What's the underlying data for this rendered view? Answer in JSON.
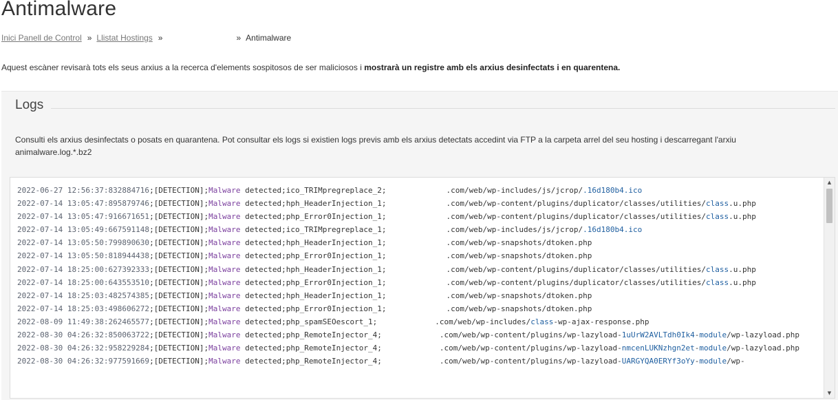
{
  "page": {
    "title": "Antimalware"
  },
  "breadcrumb": {
    "items": [
      {
        "label": "Inici Panell de Control"
      },
      {
        "label": "Llistat Hostings"
      },
      {
        "label": ""
      },
      {
        "label": "Antimalware"
      }
    ],
    "separator": "»"
  },
  "intro": {
    "text": "Aquest escàner revisarà tots els seus arxius a la recerca d'elements sospitosos de ser maliciosos i ",
    "bold": "mostrarà un registre amb els arxius desinfectats i en quarentena."
  },
  "logs": {
    "legend": "Logs",
    "description": "Consulti els arxius desinfectats o posats en quarantena. Pot consultar els logs si existien logs previs amb els arxius detectats accedint via FTP a la carpeta arrel del seu hosting i descarregant l'arxiu animalware.log.*.bz2",
    "entries": [
      {
        "ts": "2022-06-27 12:56:37:832884716",
        "tag": "[DETECTION]",
        "kw": "Malware",
        "det": " detected;",
        "sig": "ico_TRIMpregreplace_2;",
        "path": [
          ".com/web/wp-includes/js/jcrop/",
          ".16d180b4.ico"
        ]
      },
      {
        "ts": "2022-07-14 13:05:47:895879746",
        "tag": "[DETECTION]",
        "kw": "Malware",
        "det": " detected;",
        "sig": "hph_HeaderInjection_1;",
        "path": [
          ".com/web/wp-content/plugins/duplicator/classes/utilities/",
          "class",
          ".u.php"
        ]
      },
      {
        "ts": "2022-07-14 13:05:47:916671651",
        "tag": "[DETECTION]",
        "kw": "Malware",
        "det": " detected;",
        "sig": "php_Error0Injection_1;",
        "path": [
          ".com/web/wp-content/plugins/duplicator/classes/utilities/",
          "class",
          ".u.php"
        ]
      },
      {
        "ts": "2022-07-14 13:05:49:667591148",
        "tag": "[DETECTION]",
        "kw": "Malware",
        "det": " detected;",
        "sig": "ico_TRIMpregreplace_1;",
        "path": [
          ".com/web/wp-includes/js/jcrop/",
          ".16d180b4.ico"
        ]
      },
      {
        "ts": "2022-07-14 13:05:50:799890630",
        "tag": "[DETECTION]",
        "kw": "Malware",
        "det": " detected;",
        "sig": "hph_HeaderInjection_1;",
        "path": [
          ".com/web/wp-snapshots/dtoken.php"
        ]
      },
      {
        "ts": "2022-07-14 13:05:50:818944438",
        "tag": "[DETECTION]",
        "kw": "Malware",
        "det": " detected;",
        "sig": "php_Error0Injection_1;",
        "path": [
          ".com/web/wp-snapshots/dtoken.php"
        ]
      },
      {
        "ts": "2022-07-14 18:25:00:627392333",
        "tag": "[DETECTION]",
        "kw": "Malware",
        "det": " detected;",
        "sig": "hph_HeaderInjection_1;",
        "path": [
          ".com/web/wp-content/plugins/duplicator/classes/utilities/",
          "class",
          ".u.php"
        ]
      },
      {
        "ts": "2022-07-14 18:25:00:643553510",
        "tag": "[DETECTION]",
        "kw": "Malware",
        "det": " detected;",
        "sig": "php_Error0Injection_1;",
        "path": [
          ".com/web/wp-content/plugins/duplicator/classes/utilities/",
          "class",
          ".u.php"
        ]
      },
      {
        "ts": "2022-07-14 18:25:03:482574385",
        "tag": "[DETECTION]",
        "kw": "Malware",
        "det": " detected;",
        "sig": "hph_HeaderInjection_1;",
        "path": [
          ".com/web/wp-snapshots/dtoken.php"
        ]
      },
      {
        "ts": "2022-07-14 18:25:03:498606272",
        "tag": "[DETECTION]",
        "kw": "Malware",
        "det": " detected;",
        "sig": "php_Error0Injection_1;",
        "path": [
          ".com/web/wp-snapshots/dtoken.php"
        ]
      },
      {
        "ts": "2022-08-09 11:49:38:262465577",
        "tag": "[DETECTION]",
        "kw": "Malware",
        "det": " detected;",
        "sig": "php_spamSEOescort_1;",
        "path": [
          ".com/web/wp-includes/",
          "class",
          "-wp-ajax-response.php"
        ]
      },
      {
        "ts": "2022-08-30 04:26:32:850063722",
        "tag": "[DETECTION]",
        "kw": "Malware",
        "det": " detected;",
        "sig": "php_RemoteInjector_4;",
        "path": [
          ".com/web/wp-content/plugins/wp-lazyload-",
          "1uUrW2AVLTdh0Ik4",
          "-",
          "module",
          "/wp-lazyload.php"
        ]
      },
      {
        "ts": "2022-08-30 04:26:32:958229284",
        "tag": "[DETECTION]",
        "kw": "Malware",
        "det": " detected;",
        "sig": "php_RemoteInjector_4;",
        "path": [
          ".com/web/wp-content/plugins/wp-lazyload-",
          "nmcenLUKNzhgn2et",
          "-",
          "module",
          "/wp-lazyload.php"
        ]
      },
      {
        "ts": "2022-08-30 04:26:32:977591669",
        "tag": "[DETECTION]",
        "kw": "Malware",
        "det": " detected;",
        "sig": "php_RemoteInjector_4;",
        "path": [
          ".com/web/wp-content/plugins/wp-lazyload-",
          "UARGYQA0ERYf3oYy",
          "-",
          "module",
          "/wp-"
        ]
      }
    ]
  },
  "scrollbar": {
    "up_icon": "arrow-up-icon",
    "down_icon": "arrow-down-icon",
    "up_glyph": "▲",
    "down_glyph": "▼"
  }
}
